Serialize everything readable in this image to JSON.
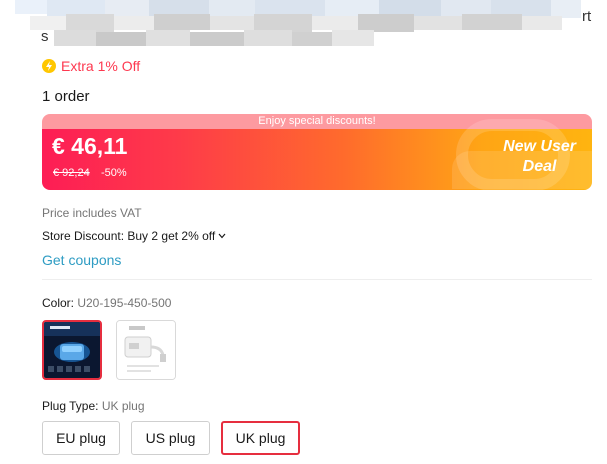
{
  "product": {
    "title_trailing_chars": [
      "rt",
      "s"
    ]
  },
  "promo": {
    "extra_off": "Extra 1% Off",
    "coin_icon": "lightning-coin-icon"
  },
  "orders": "1 order",
  "banner": {
    "top_text": "Enjoy special discounts!",
    "price": "€ 46,11",
    "original_price": "€ 92,24",
    "discount": "-50%",
    "deal_label_line1": "New User",
    "deal_label_line2": "Deal",
    "colors": {
      "start": "#fd1d55",
      "end": "#ffb410",
      "top_strip": "#fd9aa0"
    }
  },
  "pricing_notes": {
    "vat": "Price includes VAT",
    "store_discount": "Store Discount: Buy 2 get 2% off",
    "get_coupons": "Get coupons"
  },
  "color_option": {
    "label": "Color: ",
    "selected_value": "U20-195-450-500",
    "swatches": [
      {
        "name": "projector",
        "selected": true
      },
      {
        "name": "adapter",
        "selected": false
      }
    ]
  },
  "plug_type": {
    "label": "Plug Type: ",
    "selected_value": "UK plug",
    "options": [
      "EU plug",
      "US plug",
      "UK plug"
    ]
  },
  "accent_colors": {
    "selected_border": "#e62e3f",
    "link": "#2e9cc3",
    "promo_red": "#fd384f"
  }
}
